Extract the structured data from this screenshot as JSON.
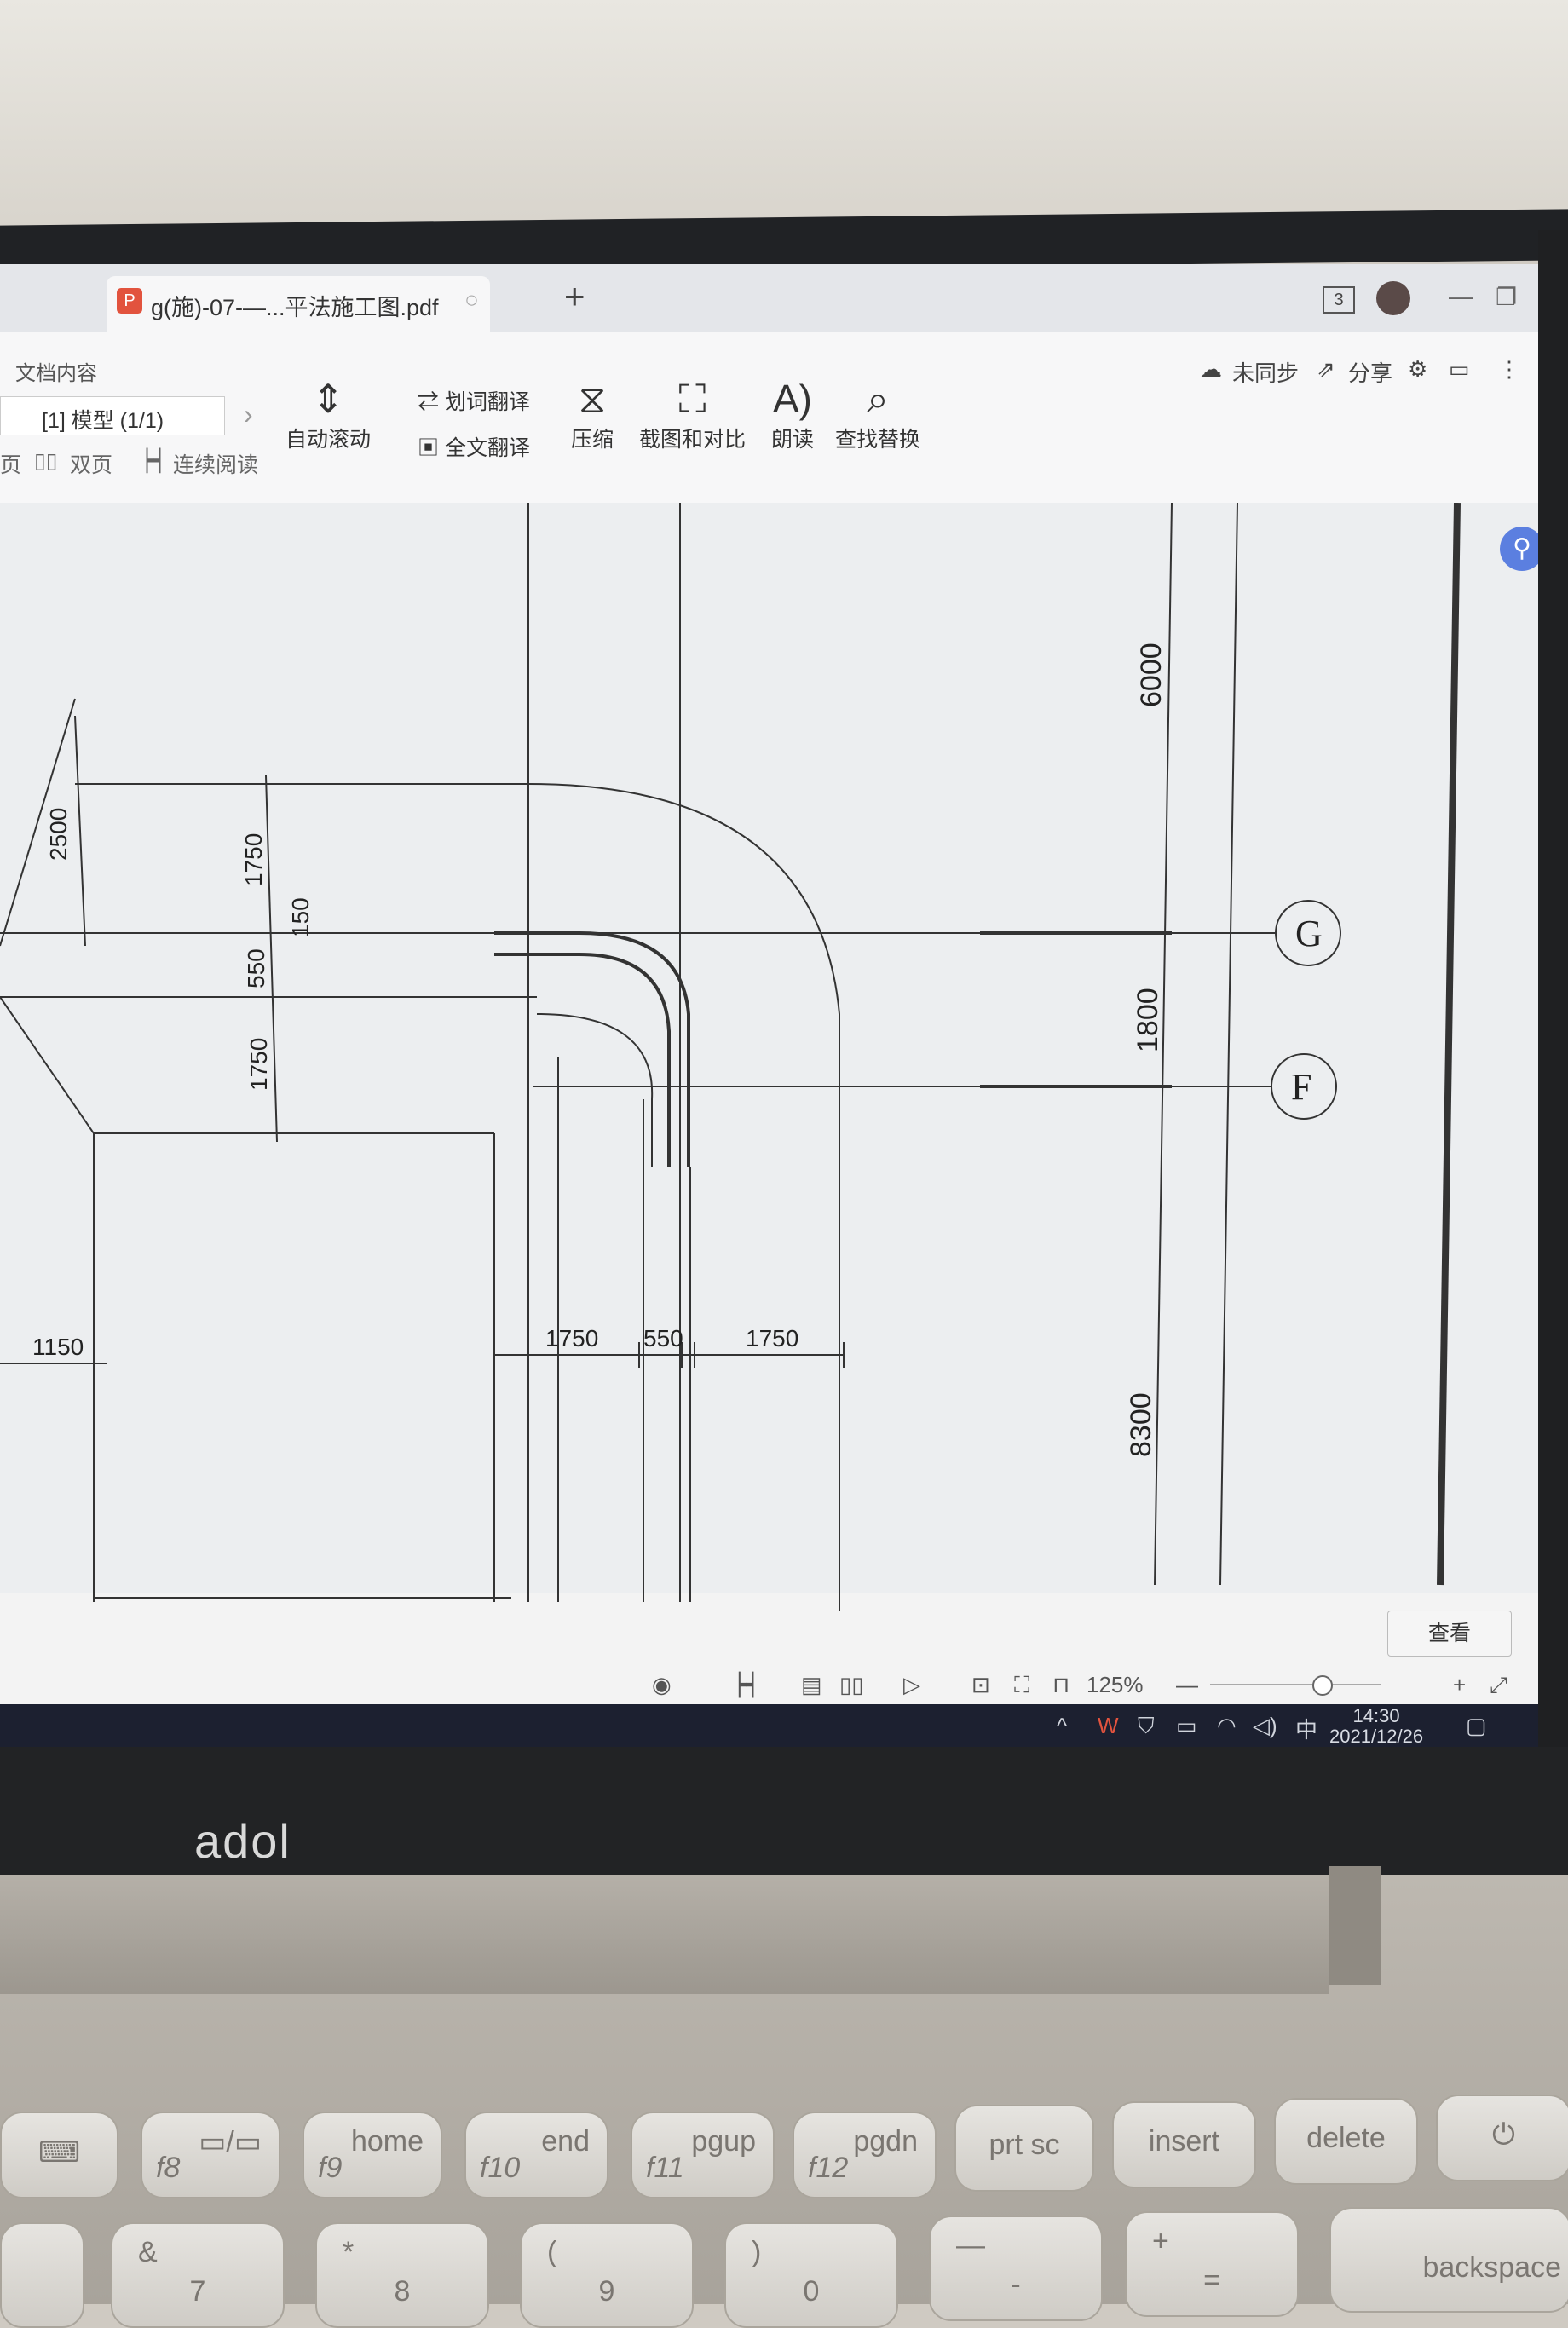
{
  "tabbar": {
    "tab_title": "g(施)-07-—...平法施工图.pdf",
    "new_tab": "+",
    "tab_count": "3",
    "minimize": "—",
    "restore": "❐",
    "close": "✕"
  },
  "ribbon": {
    "doc_content": "文档内容",
    "sync": "未同步",
    "share": "分享",
    "page_selector": "[1] 模型 (1/1)",
    "view_page": "页",
    "view_double": "双页",
    "view_continuous": "连续阅读",
    "auto_scroll": "自动滚动",
    "word_translate": "划词翻译",
    "full_translate": "全文翻译",
    "compress": "压缩",
    "screenshot_compare": "截图和对比",
    "read_aloud": "朗读",
    "find_replace": "查找替换"
  },
  "drawing": {
    "dims": {
      "d2500": "2500",
      "d1750_a": "1750",
      "d150": "150",
      "d550_a": "550",
      "d1750_b": "1750",
      "d1150": "1150",
      "d1750_c": "1750",
      "d550_b": "550",
      "d1750_d": "1750",
      "d6000": "6000",
      "d1800": "1800",
      "d8300": "8300"
    },
    "axis_g": "G",
    "axis_f": "F"
  },
  "view_button": "查看",
  "statusbar": {
    "zoom": "125%",
    "zoom_out": "—",
    "zoom_in": "+"
  },
  "taskbar": {
    "ime": "中",
    "time": "14:30",
    "date": "2021/12/26"
  },
  "laptop": {
    "brand": "adol"
  },
  "keyboard": {
    "f8": "f8",
    "f9": "f9",
    "f9_alt": "home",
    "f10": "f10",
    "f10_alt": "end",
    "f11": "f11",
    "f11_alt": "pgup",
    "f12": "f12",
    "f12_alt": "pgdn",
    "prtsc": "prt sc",
    "insert": "insert",
    "delete": "delete",
    "k7_top": "&",
    "k7": "7",
    "k8_top": "*",
    "k8": "8",
    "k9_top": "(",
    "k9": "9",
    "k0_top": ")",
    "k0": "0",
    "minus_top": "—",
    "minus": "-",
    "plus_top": "+",
    "equals": "=",
    "backspace": "backspace"
  }
}
